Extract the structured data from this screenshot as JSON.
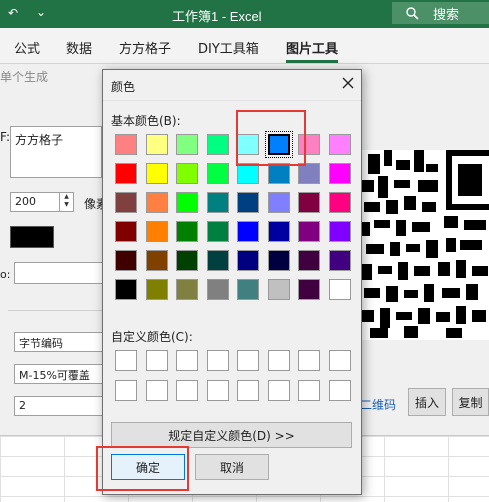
{
  "titlebar": {
    "title": "工作簿1  -  Excel",
    "search_label": "搜索",
    "undo_glyph": "↶",
    "qa_glyph": "⌄"
  },
  "ribbon": {
    "tabs": [
      {
        "label": "公式"
      },
      {
        "label": "数据"
      },
      {
        "label": "方方格子"
      },
      {
        "label": "DIY工具箱"
      },
      {
        "label": "图片工具"
      }
    ],
    "active_index": 4
  },
  "bg": {
    "title": "单个生成",
    "text_label": "F:",
    "text_value": "方方格子",
    "size_value": "200",
    "pixel_label": "像素",
    "o_label": "o:",
    "selects": [
      "字节编码",
      "M-15%可覆盖",
      "2"
    ],
    "qr_link": "二维码",
    "insert_label": "插入",
    "copy_label": "复制"
  },
  "dialog": {
    "title": "颜色",
    "basic_label": "基本颜色(B):",
    "custom_label": "自定义颜色(C):",
    "define_label": "规定自定义颜色(D) >>",
    "ok_label": "确定",
    "cancel_label": "取消",
    "selected_color": "#0080ff",
    "basic_colors": [
      [
        "#ff8080",
        "#ffff80",
        "#80ff80",
        "#00ff80",
        "#80ffff",
        "#0080ff",
        "#ff80c0",
        "#ff80ff"
      ],
      [
        "#ff0000",
        "#ffff00",
        "#80ff00",
        "#00ff40",
        "#00ffff",
        "#0080c0",
        "#8080c0",
        "#ff00ff"
      ],
      [
        "#804040",
        "#ff8040",
        "#00ff00",
        "#008080",
        "#004080",
        "#8080ff",
        "#800040",
        "#ff0080"
      ],
      [
        "#800000",
        "#ff8000",
        "#008000",
        "#008040",
        "#0000ff",
        "#0000a0",
        "#800080",
        "#8000ff"
      ],
      [
        "#400000",
        "#804000",
        "#004000",
        "#004040",
        "#000080",
        "#000040",
        "#400040",
        "#400080"
      ],
      [
        "#000000",
        "#808000",
        "#808040",
        "#808080",
        "#408080",
        "#c0c0c0",
        "#400040",
        "#ffffff"
      ]
    ]
  }
}
